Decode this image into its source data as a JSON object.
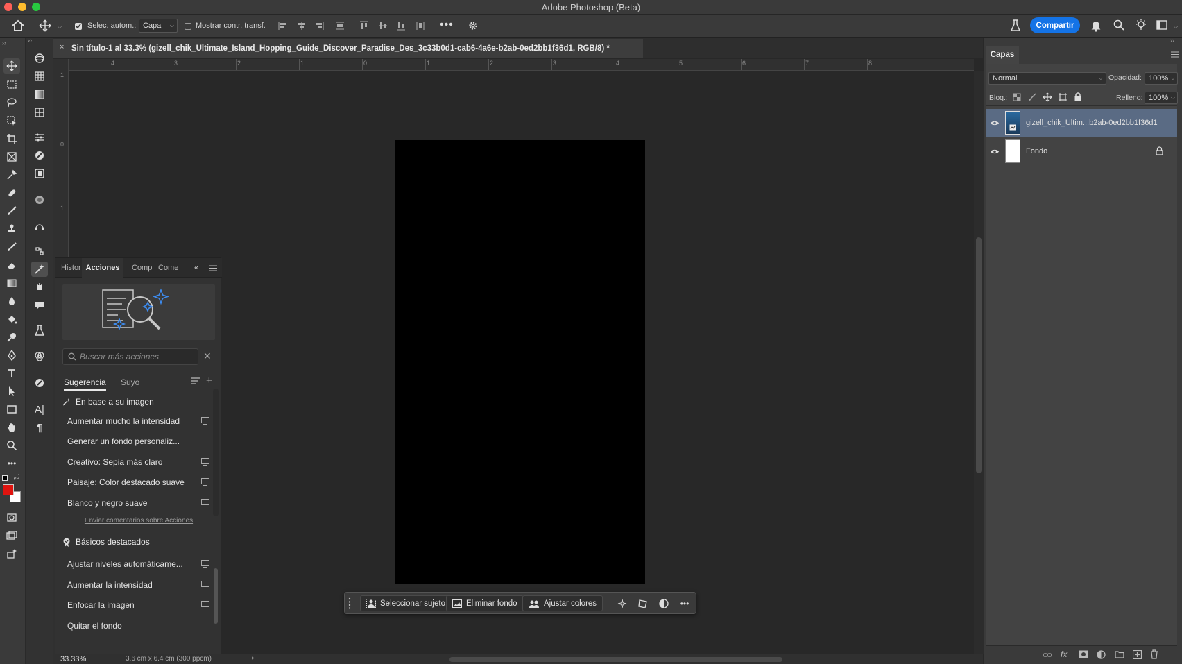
{
  "app": {
    "title": "Adobe Photoshop (Beta)"
  },
  "options_bar": {
    "auto_select_label": "Selec. autom.:",
    "auto_select_target": "Capa",
    "show_transform_label": "Mostrar contr. transf.",
    "share_label": "Compartir",
    "colors": {
      "share": "#1473e6"
    }
  },
  "document": {
    "tab_title": "Sin título-1 al 33.3% (gizell_chik_Ultimate_Island_Hopping_Guide_Discover_Paradise_Des_3c33b0d1-cab6-4a6e-b2ab-0ed2bb1f36d1, RGB/8) *",
    "zoom": "33.33%",
    "size_info": "3.6 cm x 6.4 cm (300 ppcm)"
  },
  "ruler": {
    "h_ticks": [
      "4",
      "3",
      "2",
      "1",
      "0",
      "1",
      "2",
      "3",
      "4",
      "5",
      "6",
      "7",
      "8"
    ],
    "v_ticks": [
      "1",
      "0",
      "1"
    ]
  },
  "taskbar": {
    "select_subject": "Seleccionar sujeto",
    "remove_bg": "Eliminar fondo",
    "adjust_colors": "Ajustar colores"
  },
  "actions_panel": {
    "tabs": [
      "Histor",
      "Acciones",
      "Comp",
      "Come"
    ],
    "search_placeholder": "Buscar más acciones",
    "filter_tabs": [
      "Sugerencia",
      "Suyo"
    ],
    "section1": "En base a su imagen",
    "items1": [
      "Aumentar mucho la intensidad",
      "Generar un fondo personaliz...",
      "Creativo: Sepia más claro",
      "Paisaje: Color destacado suave",
      "Blanco y negro suave"
    ],
    "feedback_link": "Enviar comentarios sobre Acciones",
    "section2": "Básicos destacados",
    "items2": [
      "Ajustar niveles automáticame...",
      "Aumentar la intensidad",
      "Enfocar la imagen",
      "Quitar el fondo"
    ]
  },
  "layers_panel": {
    "tab": "Capas",
    "blend_mode": "Normal",
    "opacity_label": "Opacidad:",
    "opacity": "100%",
    "lock_label": "Bloq.:",
    "fill_label": "Relleno:",
    "fill": "100%",
    "layers": [
      {
        "name": "gizell_chik_Ultim...b2ab-0ed2bb1f36d1",
        "selected": true
      },
      {
        "name": "Fondo",
        "locked": true
      }
    ]
  },
  "colors": {
    "foreground": "#e0140f",
    "background": "#ffffff",
    "accent": "#1473e6"
  }
}
